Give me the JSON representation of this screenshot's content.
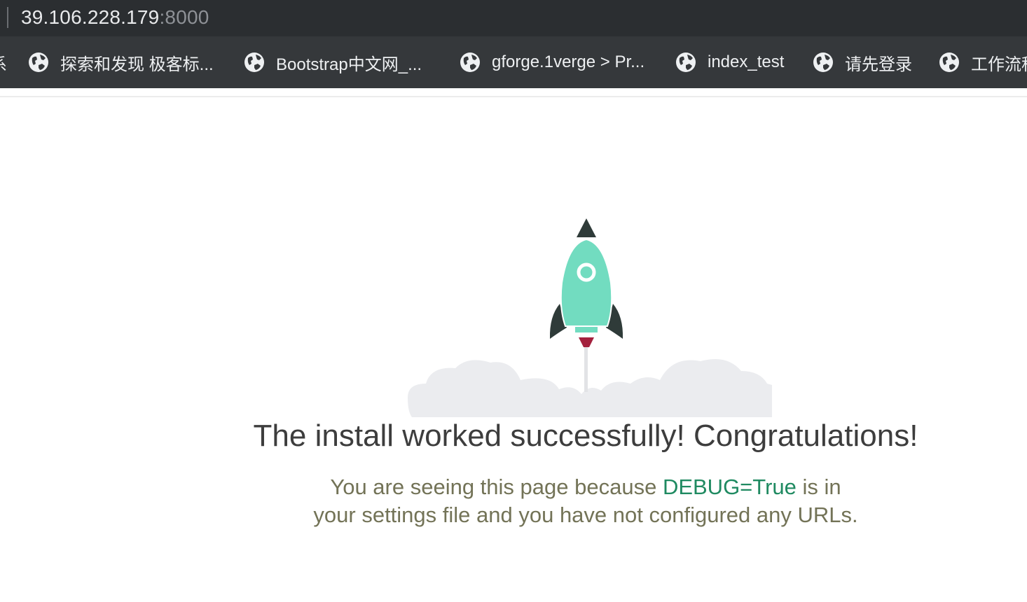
{
  "address_bar": {
    "host": "39.106.228.179",
    "port": ":8000"
  },
  "bookmarks": {
    "partial_left": "系",
    "items": [
      {
        "label": "探索和发现 极客标..."
      },
      {
        "label": "Bootstrap中文网_..."
      },
      {
        "label": "gforge.1verge > Pr..."
      },
      {
        "label": "index_test"
      },
      {
        "label": "请先登录"
      },
      {
        "label": "工作流程"
      }
    ],
    "icon": "globe-icon"
  },
  "page": {
    "headline": "The install worked successfully! Congratulations!",
    "sub_before": "You are seeing this page because ",
    "sub_debug": "DEBUG=True",
    "sub_after": " is in your settings file and you have not configured any URLs."
  },
  "colors": {
    "rocket_body": "#72dcc0",
    "rocket_dark": "#2f3b39",
    "flame": "#a3203d",
    "cloud": "#ebecef",
    "debug_highlight": "#1f8a61",
    "subtext": "#737357"
  }
}
